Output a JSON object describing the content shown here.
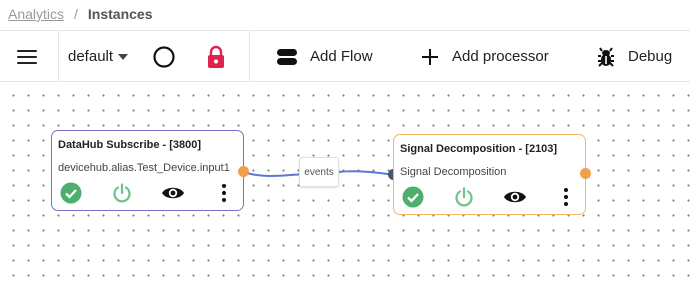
{
  "breadcrumb": {
    "root": "Analytics",
    "separator": "/",
    "current": "Instances"
  },
  "toolbar": {
    "menu_icon": "hamburger-icon",
    "dropdown_value": "default",
    "status_icon": "circle-icon",
    "lock_icon": "lock-icon",
    "add_flow_label": "Add Flow",
    "add_processor_label": "Add processor",
    "debug_label": "Debug"
  },
  "nodes": [
    {
      "title": "DataHub Subscribe - [3800]",
      "subtitle": "devicehub.alias.Test_Device.input1",
      "border_color": "#7b6fc6",
      "actions": [
        "check-circle-icon",
        "power-icon",
        "eye-icon",
        "more-vert-icon"
      ]
    },
    {
      "title": "Signal Decomposition - [2103]",
      "subtitle": "Signal Decomposition",
      "border_color": "#f0b86a",
      "actions": [
        "check-circle-icon",
        "power-icon",
        "eye-icon",
        "more-vert-icon"
      ]
    }
  ],
  "edge": {
    "label": "events",
    "color": "#5b78d6"
  },
  "colors": {
    "check": "#4caf6e",
    "power": "#6cc38a",
    "lock": "#e0234d",
    "port_out": "#f0a04b",
    "port_in": "#44576b"
  }
}
